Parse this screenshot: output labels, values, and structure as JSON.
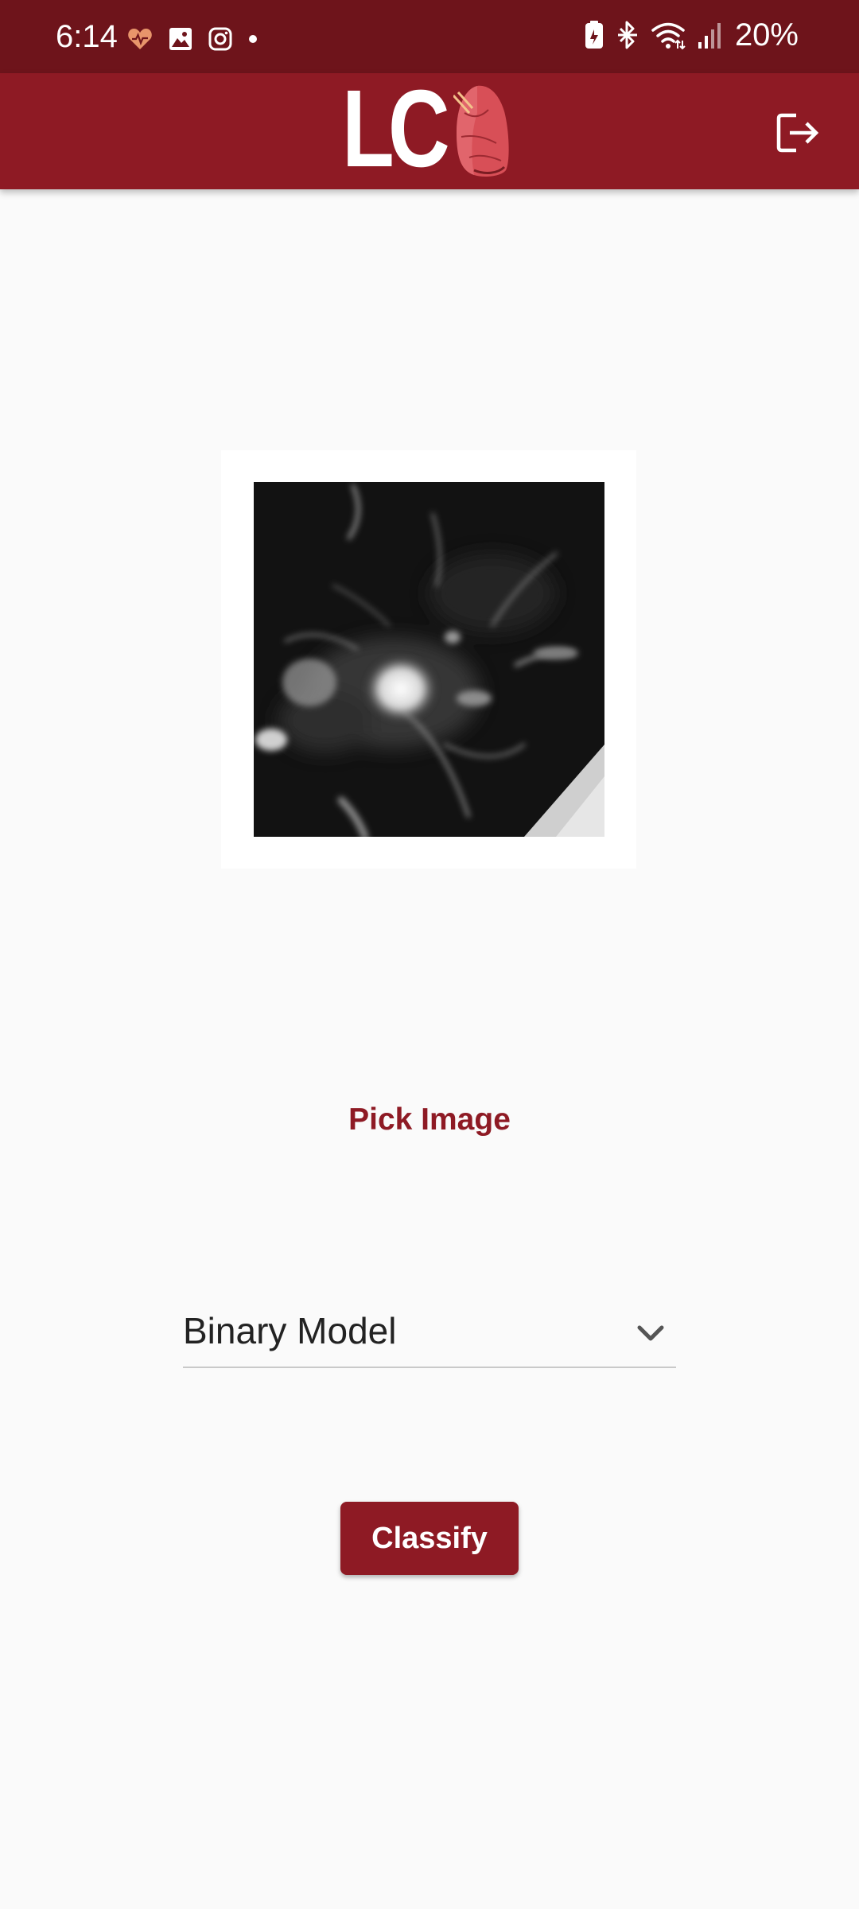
{
  "status_bar": {
    "time": "6:14",
    "battery": "20%",
    "left_icons": [
      "heart-health-icon",
      "gallery-icon",
      "instagram-icon",
      "dot-icon"
    ],
    "right_icons": [
      "battery-saver-icon",
      "bluetooth-icon",
      "wifi-icon",
      "signal-icon"
    ]
  },
  "app_bar": {
    "logo_text": "LC",
    "logo_icon": "lung-icon",
    "logout_icon": "logout-icon"
  },
  "main": {
    "image_alt": "CT scan image",
    "pick_image_label": "Pick Image",
    "model_select": {
      "selected": "Binary Model"
    },
    "classify_label": "Classify"
  },
  "colors": {
    "status_bar": "#6e141b",
    "app_bar": "#8e1a24",
    "accent": "#8e1a24",
    "background": "#fafafa"
  }
}
